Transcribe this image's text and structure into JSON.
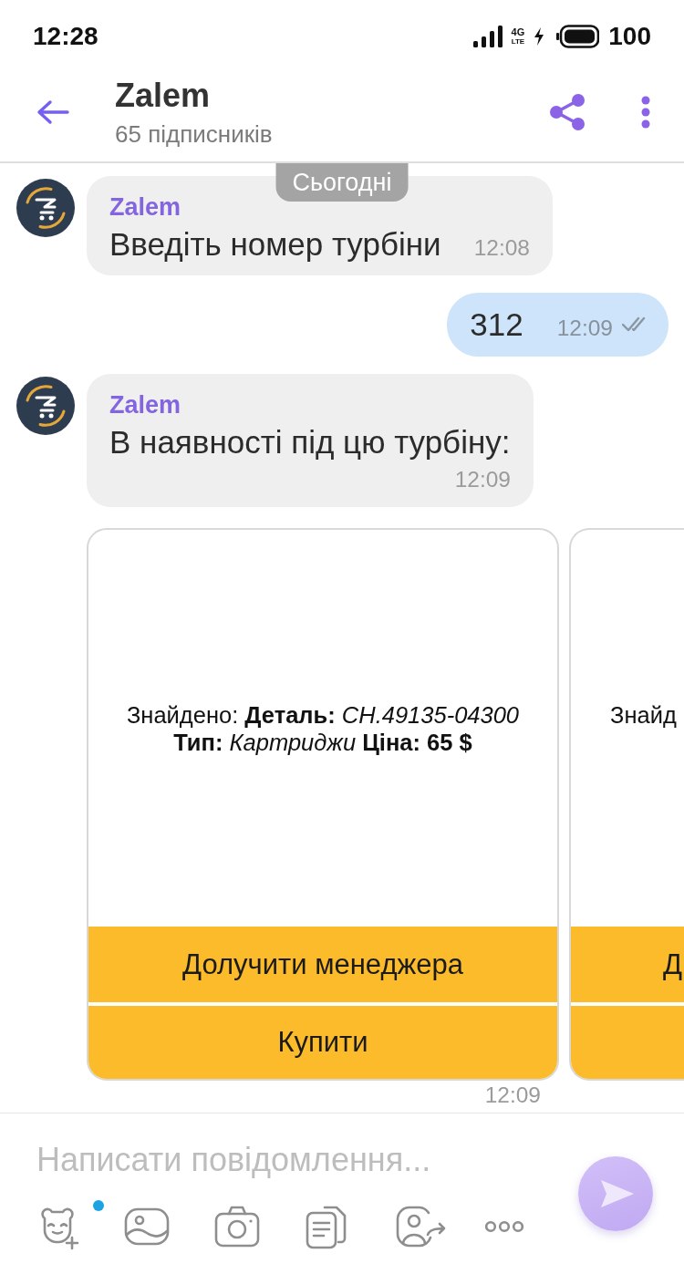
{
  "status_bar": {
    "time": "12:28",
    "network": "4G",
    "network_sub": "LTE",
    "battery": "100"
  },
  "header": {
    "title": "Zalem",
    "subtitle": "65 підписників"
  },
  "date_chip": "Сьогодні",
  "messages": [
    {
      "kind": "incoming",
      "sender": "Zalem",
      "text": "Введіть номер турбіни",
      "time": "12:08"
    },
    {
      "kind": "outgoing",
      "text": "312",
      "time": "12:09",
      "seen": false
    },
    {
      "kind": "incoming",
      "sender": "Zalem",
      "text": "В наявності під цю турбіну:",
      "time": "12:09"
    },
    {
      "kind": "carousel",
      "time": "12:09",
      "cards": [
        {
          "cut": false,
          "lines": [
            "Знайдено: **Деталь:** *CH.49135-04300*",
            "**Тип:** *Картриджи* **Ціна: 65 $**"
          ],
          "buttons": [
            {
              "label": "Долучити менеджера"
            },
            {
              "label": "Купити"
            }
          ]
        },
        {
          "cut": true,
          "lines": [
            "Знайд"
          ],
          "buttons": [
            {
              "label": "Д"
            }
          ]
        }
      ]
    }
  ],
  "composer": {
    "placeholder": "Написати повідомлення...",
    "tools": [
      {
        "kind": "sticker",
        "badge": true
      },
      {
        "kind": "gallery",
        "badge": false
      },
      {
        "kind": "camera",
        "badge": false
      },
      {
        "kind": "document",
        "badge": false
      },
      {
        "kind": "contact",
        "badge": false
      },
      {
        "kind": "more",
        "badge": false
      }
    ]
  }
}
